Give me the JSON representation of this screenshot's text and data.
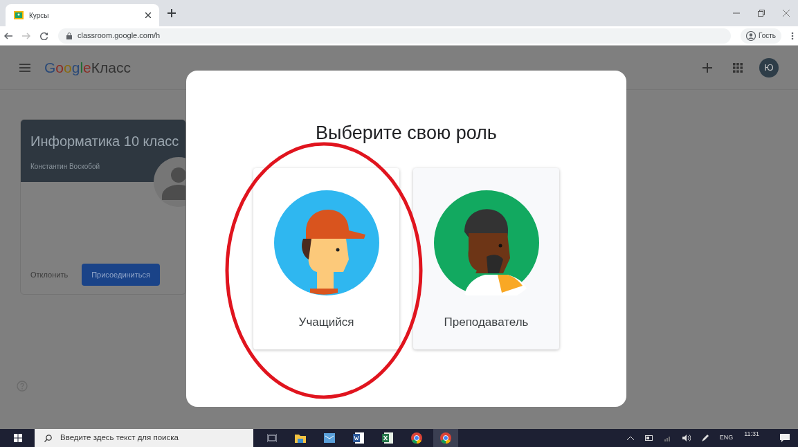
{
  "browser": {
    "tabs": [
      {
        "title": "Курсы",
        "selected": true
      }
    ],
    "address": "classroom.google.com/h",
    "profile": "Гость"
  },
  "app": {
    "logo_brand": "Google",
    "logo_product": "Класс",
    "avatar": "Ю"
  },
  "class_card": {
    "title": "Информатика 10 класс",
    "teacher": "Константин Воскобой",
    "decline": "Отклонить",
    "join": "Присоединиться"
  },
  "dialog": {
    "title": "Выберите свою роль",
    "roles": [
      {
        "kind": "student",
        "label": "Учащийся"
      },
      {
        "kind": "teacher",
        "label": "Преподаватель"
      }
    ]
  },
  "taskbar": {
    "search_placeholder": "Введите здесь текст для поиска",
    "language": "ENG",
    "time": "11:31"
  }
}
